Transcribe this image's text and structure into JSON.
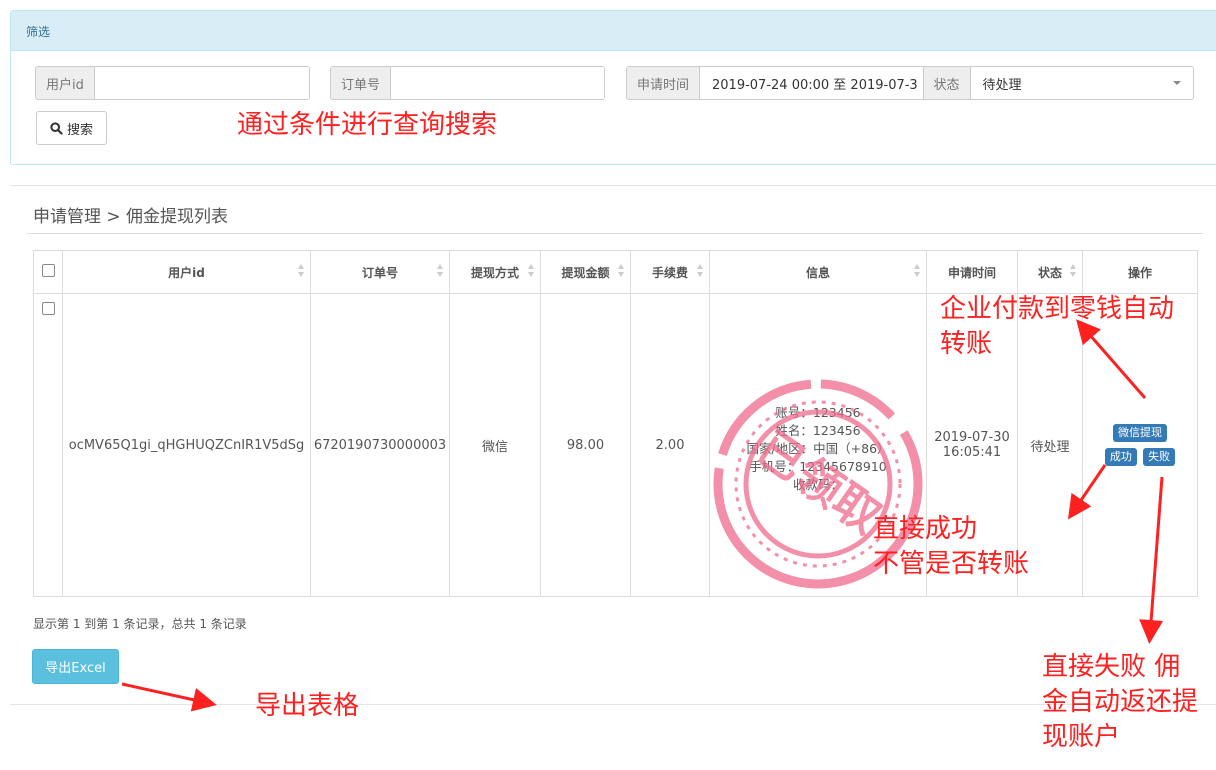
{
  "filter": {
    "title": "筛选",
    "user_id_label": "用户id",
    "user_id_value": "",
    "order_label": "订单号",
    "order_value": "",
    "time_label": "申请时间",
    "time_value": "2019-07-24 00:00 至 2019-07-3",
    "status_label": "状态",
    "status_value": "待处理",
    "search_button": "搜索"
  },
  "breadcrumb": "申请管理 > 佣金提现列表",
  "table": {
    "columns": [
      "用户id",
      "订单号",
      "提现方式",
      "提现金额",
      "手续费",
      "信息",
      "申请时间",
      "状态",
      "操作"
    ],
    "rows": [
      {
        "user_id": "ocMV65Q1gi_qHGHUQZCnIR1V5dSg",
        "order_no": "6720190730000003",
        "method": "微信",
        "amount": "98.00",
        "fee": "2.00",
        "info": [
          "账号：123456",
          "姓名：123456",
          "国家/地区：中国（+86）",
          "手机号：12345678910",
          "收款码："
        ],
        "apply_date": "2019-07-30",
        "apply_time": "16:05:41",
        "status": "待处理",
        "actions": {
          "wechat": "微信提现",
          "success": "成功",
          "fail": "失败"
        }
      }
    ]
  },
  "footer_text": "显示第 1 到第 1 条记录，总共 1 条记录",
  "export_button": "导出Excel",
  "stamp_text": "已领取",
  "annotations": {
    "search": "通过条件进行查询搜索",
    "wechat_line1": "企业付款到零钱自动",
    "wechat_line2": "转账",
    "success_line1": "直接成功",
    "success_line2": "不管是否转账",
    "fail_line1": "直接失败  佣",
    "fail_line2": "金自动返还提",
    "fail_line3": "现账户",
    "export": "导出表格"
  },
  "colors": {
    "accent": "#337ab7",
    "annotation": "#ff2020",
    "stamp": "#f06a8c",
    "export": "#5bc0de"
  }
}
